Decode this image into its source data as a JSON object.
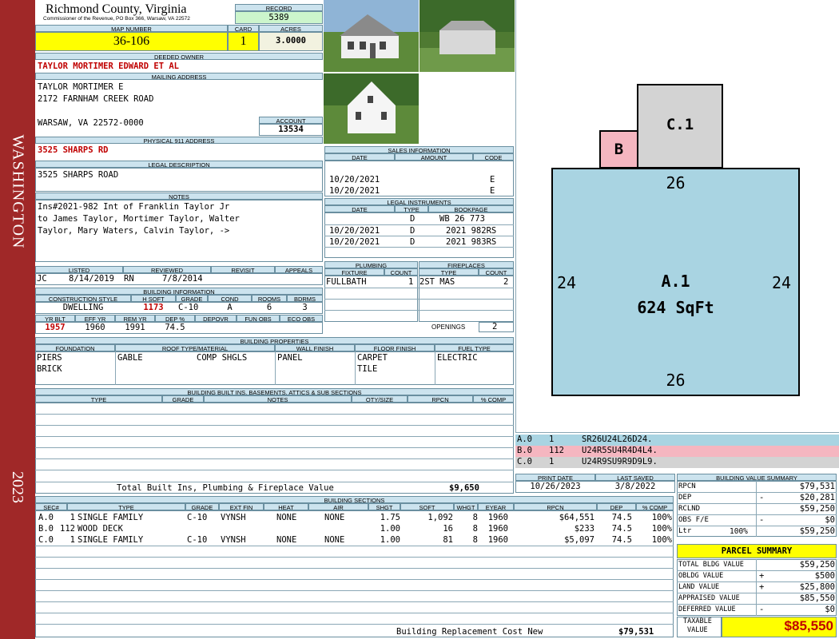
{
  "side": {
    "district": "WASHINGTON",
    "year": "2023"
  },
  "county": {
    "name": "Richmond County, Virginia",
    "sub": "Commissioner of the Revenue, PO Box 366, Warsaw, VA 22572"
  },
  "labels": {
    "record": "RECORD",
    "map_number": "MAP NUMBER",
    "card": "CARD",
    "acres": "ACRES",
    "deeded_owner": "DEEDED OWNER",
    "mailing_address": "MAILING ADDRESS",
    "account": "ACCOUNT",
    "physical": "PHYSICAL 911 ADDRESS",
    "legal": "LEGAL DESCRIPTION",
    "notes": "NOTES",
    "sales": "SALES INFORMATION",
    "date": "DATE",
    "amount": "AMOUNT",
    "code": "CODE",
    "legal_instr": "LEGAL INSTRUMENTS",
    "type": "TYPE",
    "bookpage": "BOOKPAGE",
    "listed": "LISTED",
    "reviewed": "REVIEWED",
    "revisit": "REVISIT",
    "appeals": "APPEALS",
    "plumbing": "PLUMBING",
    "fireplaces": "FIREPLACES",
    "fixture": "FIXTURE",
    "count": "COUNT",
    "openings": "OPENINGS",
    "building_info": "BUILDING INFORMATION",
    "construction_style": "CONSTRUCTION STYLE",
    "h_sqft": "H SQFT",
    "grade": "GRADE",
    "cond": "COND",
    "rooms": "ROOMS",
    "bdrms": "BDRMS",
    "yr_blt": "YR BLT",
    "eff_yr": "EFF YR",
    "rem_yr": "REM YR",
    "dep_pct": "DEP %",
    "depovr": "DEPOVR",
    "fun_obs": "FUN OBS",
    "eco_obs": "ECO OBS",
    "building_props": "BUILDING PROPERTIES",
    "foundation": "FOUNDATION",
    "roof": "ROOF TYPE/MATERIAL",
    "wall": "WALL FINISH",
    "floor": "FLOOR FINISH",
    "fuel": "FUEL TYPE",
    "built_ins": "BUILDING BUILT INS, BASEMENTS, ATTICS & SUB SECTIONS",
    "notes_col": "NOTES",
    "qty": "QTY/SIZE",
    "rpcn": "RPCN",
    "pcomp": "% COMP",
    "print_date": "PRINT DATE",
    "last_saved": "LAST SAVED",
    "bvs": "BUILDING VALUE SUMMARY",
    "sections": "BUILDING SECTIONS",
    "sec": "SEC#",
    "ext_fin": "EXT FIN",
    "heat": "HEAT",
    "air": "AIR",
    "shgt": "SHGT",
    "sqft": "SQFT",
    "whgt": "WHGT",
    "eyear": "EYEAR",
    "dep": "DEP"
  },
  "record": "5389",
  "map_number": "36-106",
  "card": "1",
  "acres": "3.0000",
  "owner": "TAYLOR MORTIMER EDWARD ET AL",
  "mailing": {
    "line1": "TAYLOR MORTIMER E",
    "line2": "2172 FARNHAM CREEK ROAD",
    "line3": "WARSAW, VA 22572-0000"
  },
  "account": "13534",
  "physical_address": "3525 SHARPS RD",
  "legal_description": "3525 SHARPS ROAD",
  "notes": {
    "line1": "Ins#2021-982 Int of Franklin Taylor Jr",
    "line2": "to James Taylor, Mortimer Taylor, Walter",
    "line3": "Taylor, Mary Waters, Calvin Taylor, ->"
  },
  "sales": [
    {
      "date": "10/20/2021",
      "amount": "",
      "code": "E"
    },
    {
      "date": "10/20/2021",
      "amount": "",
      "code": "E"
    }
  ],
  "instruments": [
    {
      "date": "",
      "type": "D",
      "book": "WB 26 773"
    },
    {
      "date": "10/20/2021",
      "type": "D",
      "book": "2021 982RS"
    },
    {
      "date": "10/20/2021",
      "type": "D",
      "book": "2021 983RS"
    }
  ],
  "listed": {
    "by": "JC",
    "date": "8/14/2019",
    "rev_by": "RN",
    "rev_date": "7/8/2014",
    "revisit": "",
    "appeals": ""
  },
  "plumbing": {
    "fixture": "FULLBATH",
    "count": "1"
  },
  "fireplaces": {
    "type": "2ST MAS",
    "count": "2",
    "openings": "2"
  },
  "building": {
    "style": "DWELLING",
    "h_sqft": "1173",
    "grade": "C-10",
    "cond": "A",
    "rooms": "6",
    "bdrms": "3",
    "yr_blt": "1957",
    "eff_yr": "1960",
    "rem_yr": "1991",
    "dep": "74.5"
  },
  "props": {
    "found1": "PIERS",
    "found2": "BRICK",
    "roof_type": "GABLE",
    "roof_mat": "COMP SHGLS",
    "wall": "PANEL",
    "floor1": "CARPET",
    "floor2": "TILE",
    "fuel": "ELECTRIC"
  },
  "built_ins_total": {
    "label": "Total Built Ins, Plumbing & Fireplace Value",
    "value": "$9,650"
  },
  "print_date": "10/26/2023",
  "last_saved": "3/8/2022",
  "sketch": {
    "a_label": "A.1",
    "a_area": "624 SqFt",
    "b_label": "B",
    "c_label": "C.1",
    "top": "26",
    "bottom": "26",
    "left": "24",
    "right": "24"
  },
  "sketch_codes": [
    {
      "sec": "A.0",
      "n": "1",
      "code": "SR26U24L26D24."
    },
    {
      "sec": "B.0",
      "n": "112",
      "code": "U24R5SU4R4D4L4."
    },
    {
      "sec": "C.0",
      "n": "1",
      "code": "U24R9SU9R9D9L9."
    }
  ],
  "value_summary": [
    {
      "label": "RPCN",
      "sign": "",
      "value": "$79,531"
    },
    {
      "label": "DEP",
      "sign": "-",
      "value": "$20,281"
    },
    {
      "label": "RCLND",
      "sign": "",
      "value": "$59,250"
    },
    {
      "label": "OBS F/E",
      "sign": "-",
      "value": "$0"
    },
    {
      "label": "Ltr",
      "pct": "100%",
      "sign": "",
      "value": "$59,250"
    }
  ],
  "parcel": {
    "title": "PARCEL SUMMARY",
    "rows": [
      {
        "label": "TOTAL BLDG VALUE",
        "sign": "",
        "value": "$59,250"
      },
      {
        "label": "OBLDG VALUE",
        "sign": "+",
        "value": "$500"
      },
      {
        "label": "LAND VALUE",
        "sign": "+",
        "value": "$25,800"
      },
      {
        "label": "APPRAISED VALUE",
        "sign": "",
        "value": "$85,550"
      },
      {
        "label": "DEFERRED VALUE",
        "sign": "-",
        "value": "$0"
      }
    ],
    "taxable_label1": "TAXABLE",
    "taxable_label2": "VALUE",
    "taxable": "$85,550"
  },
  "sections": [
    {
      "sec": "A.0",
      "n": "1",
      "type": "SINGLE FAMILY",
      "grade": "C-10",
      "ext": "VYNSH",
      "heat": "NONE",
      "air": "NONE",
      "shgt": "1.75",
      "sqft": "1,092",
      "whgt": "8",
      "eyear": "1960",
      "rpcn": "$64,551",
      "dep": "74.5",
      "comp": "100%"
    },
    {
      "sec": "B.0",
      "n": "112",
      "type": "WOOD DECK",
      "grade": "",
      "ext": "",
      "heat": "",
      "air": "",
      "shgt": "1.00",
      "sqft": "16",
      "whgt": "8",
      "eyear": "1960",
      "rpcn": "$233",
      "dep": "74.5",
      "comp": "100%"
    },
    {
      "sec": "C.0",
      "n": "1",
      "type": "SINGLE FAMILY",
      "grade": "C-10",
      "ext": "VYNSH",
      "heat": "NONE",
      "air": "NONE",
      "shgt": "1.00",
      "sqft": "81",
      "whgt": "8",
      "eyear": "1960",
      "rpcn": "$5,097",
      "dep": "74.5",
      "comp": "100%"
    }
  ],
  "replacement": {
    "label": "Building Replacement Cost New",
    "value": "$79,531"
  }
}
